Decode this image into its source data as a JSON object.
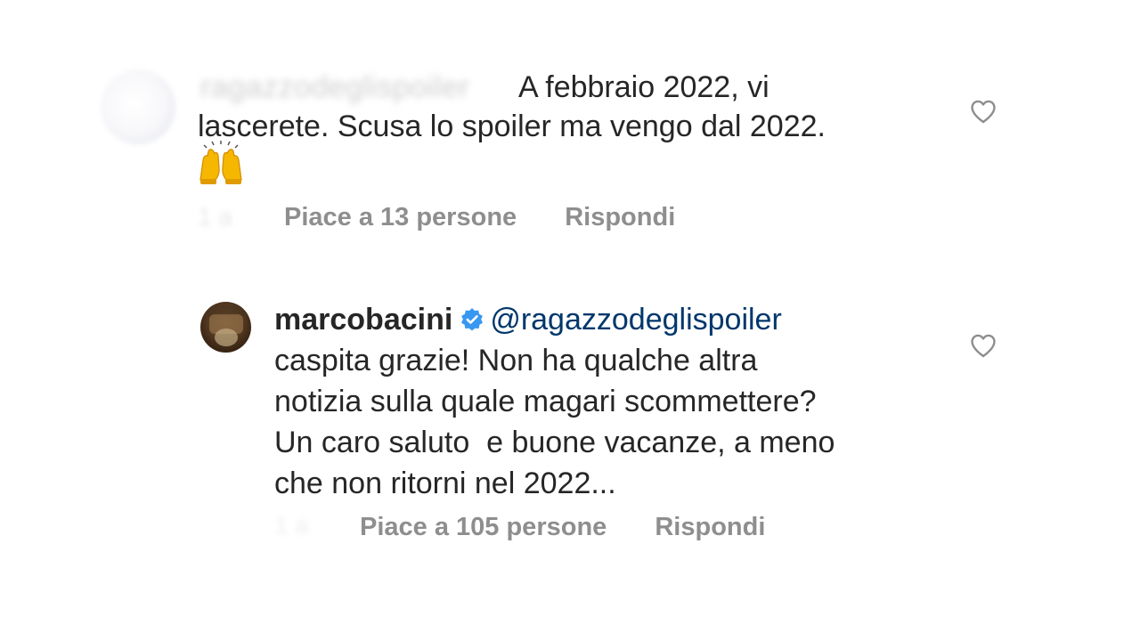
{
  "comments": [
    {
      "username": "ragazzodeglispoiler",
      "text_lines": [
        "A febbraio 2022, vi",
        "lascerete. Scusa lo spoiler ma vengo dal 2022."
      ],
      "emoji": "raising-hands-emoji",
      "time": "",
      "likes_label": "Piace a 13 persone",
      "reply_label": "Rispondi",
      "like_icon": "heart-outline-icon"
    },
    {
      "username": "marcobacini",
      "verified": true,
      "mention": "@ragazzodeglispoiler",
      "text_lines": [
        "caspita grazie! Non ha qualche altra",
        "notizia sulla quale magari scommettere?",
        "Un caro saluto  e buone vacanze, a meno",
        "che non ritorni nel 2022..."
      ],
      "time": "",
      "likes_label": "Piace a 105 persone",
      "reply_label": "Rispondi",
      "like_icon": "heart-outline-icon"
    }
  ],
  "colors": {
    "text": "#262626",
    "secondary": "#8e8e8e",
    "mention": "#00376b",
    "verified_badge": "#3897f0"
  }
}
